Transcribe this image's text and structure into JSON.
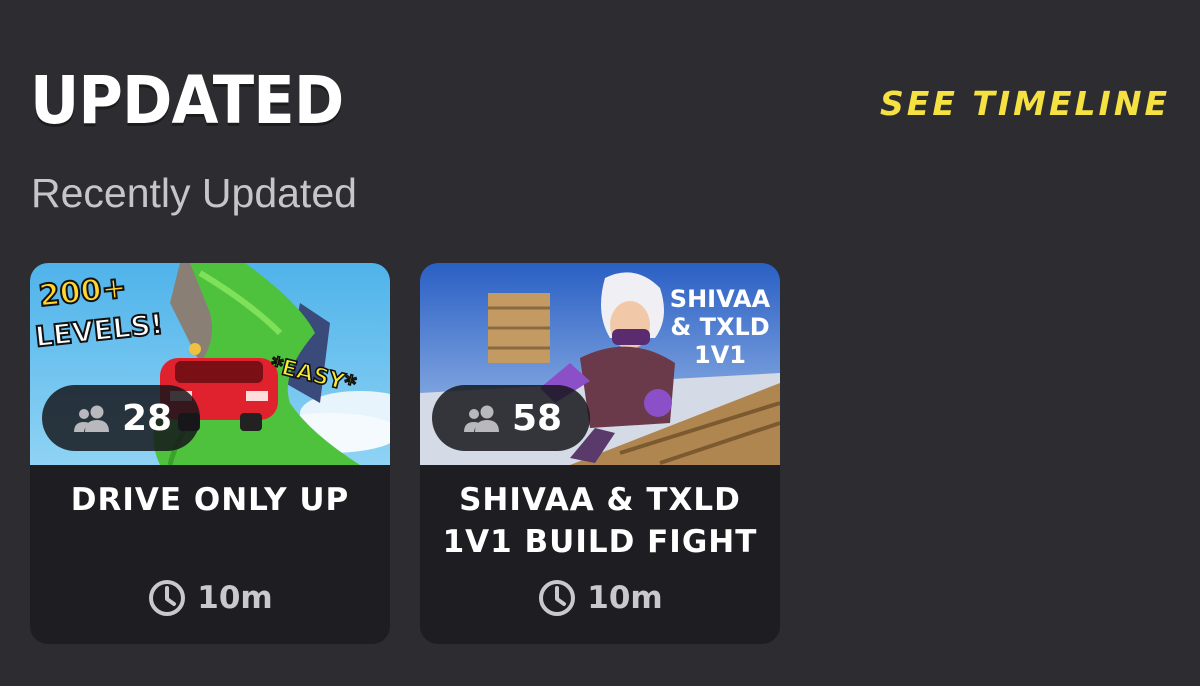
{
  "section": {
    "title": "UPDATED",
    "subtitle": "Recently Updated",
    "see_timeline_label": "SEE TIMELINE"
  },
  "colors": {
    "background": "#2c2c31",
    "card_background": "#1e1e22",
    "accent_yellow": "#f5e142",
    "title_white": "#ffffff",
    "subtitle_gray": "#c6c6c9"
  },
  "cards": [
    {
      "title": "DRIVE ONLY UP",
      "players": "28",
      "time": "10m",
      "thumbnail": {
        "overlay_line1": "200+",
        "overlay_line2": "LEVELS!",
        "overlay_tag": "*EASY*"
      },
      "icons": [
        "players-icon",
        "clock-icon"
      ]
    },
    {
      "title": "SHIVAA & TXLD 1V1 BUILD FIGHT",
      "players": "58",
      "time": "10m",
      "thumbnail": {
        "overlay_line1": "SHIVAA",
        "overlay_line2": "& TXLD",
        "overlay_line3": "1V1"
      },
      "icons": [
        "players-icon",
        "clock-icon"
      ]
    }
  ]
}
